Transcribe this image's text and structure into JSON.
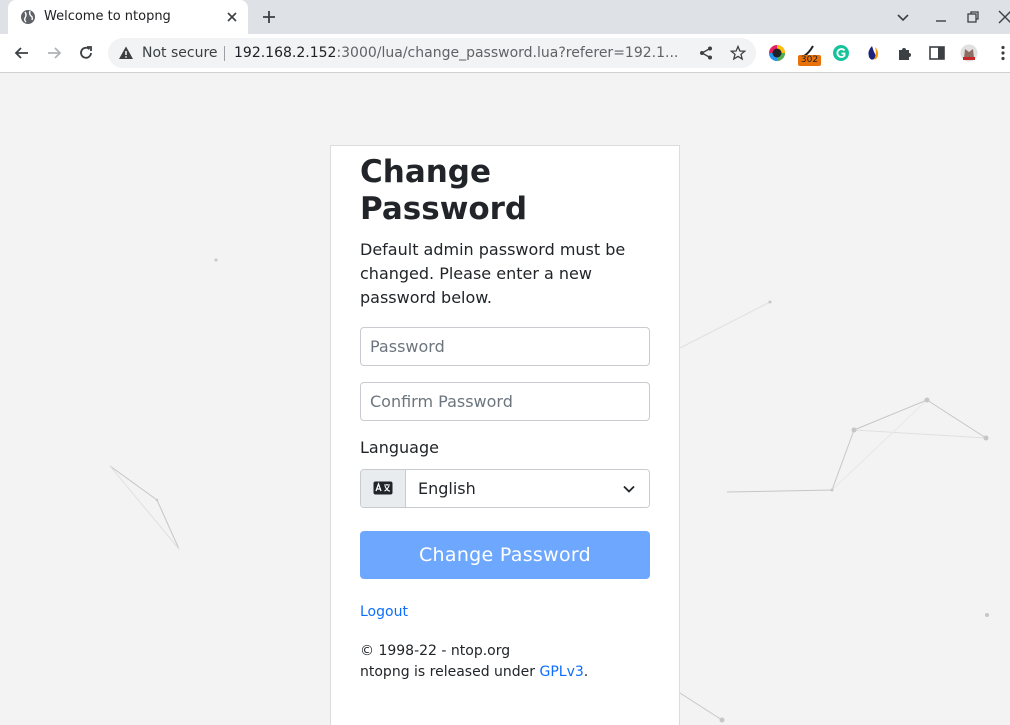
{
  "browser": {
    "tab": {
      "title": "Welcome to ntopng"
    },
    "address_bar": {
      "security_label": "Not secure",
      "url_host": "192.168.2.152",
      "url_rest": ":3000/lua/change_password.lua?referer=192.1..."
    },
    "extensions": {
      "badge_count": "302"
    }
  },
  "form": {
    "title": "Change Password",
    "description": "Default admin password must be changed. Please enter a new password below.",
    "password_placeholder": "Password",
    "confirm_placeholder": "Confirm Password",
    "language_label": "Language",
    "language_selected": "English",
    "submit_label": "Change Password",
    "logout_label": "Logout"
  },
  "footer": {
    "copyright": "© 1998-22 - ntop.org",
    "license_prefix": "ntopng is released under ",
    "license_link": "GPLv3",
    "license_suffix": "."
  },
  "colors": {
    "primary": "#0d6efd",
    "submit_button": "#6ea8fe",
    "page_background": "#f3f3f3"
  }
}
